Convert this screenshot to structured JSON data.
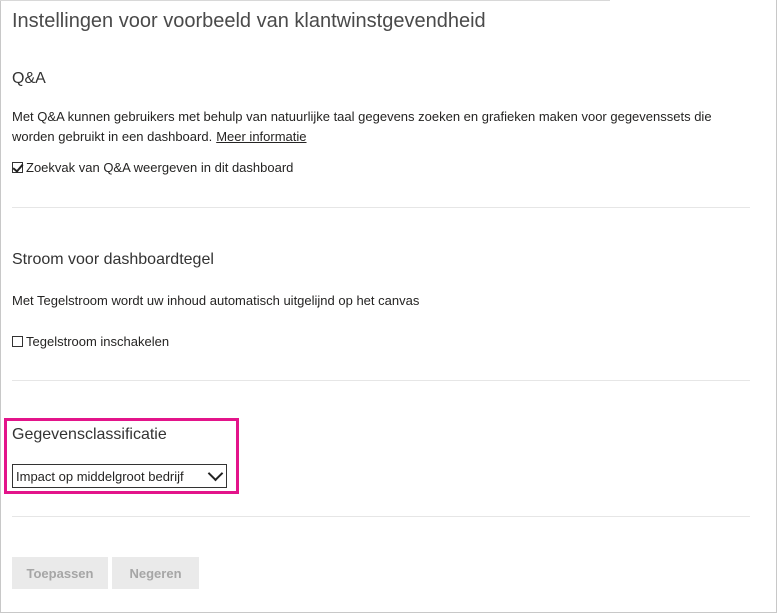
{
  "page": {
    "title": "Instellingen voor voorbeeld van klantwinstgevendheid"
  },
  "qa": {
    "heading": "Q&A",
    "description": "Met Q&A kunnen gebruikers met behulp van natuurlijke taal gegevens zoeken en grafieken maken voor gegevenssets die worden gebruikt in een dashboard.",
    "link_label": "Meer informatie",
    "checkbox_label": "Zoekvak van Q&A weergeven in dit dashboard",
    "checkbox_checked": true
  },
  "tile_flow": {
    "heading": "Stroom voor dashboardtegel",
    "description": "Met Tegelstroom wordt uw inhoud automatisch uitgelijnd op het canvas",
    "checkbox_label": "Tegelstroom inschakelen",
    "checkbox_checked": false
  },
  "classification": {
    "heading": "Gegevensclassificatie",
    "selected_value": "Impact op middelgroot bedrijf",
    "highlight_color": "#e3148a"
  },
  "actions": {
    "apply_label": "Toepassen",
    "discard_label": "Negeren"
  }
}
